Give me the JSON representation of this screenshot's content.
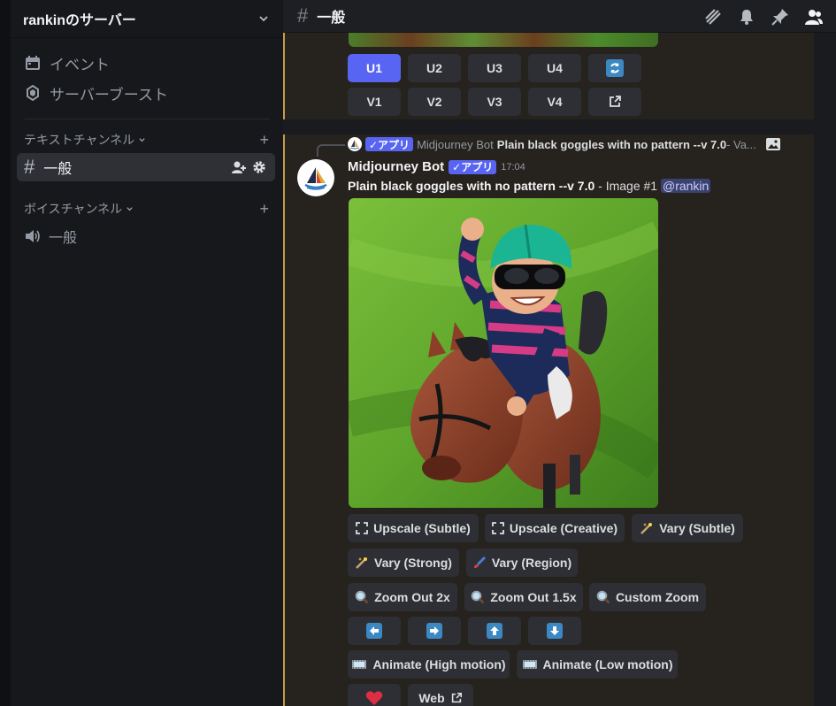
{
  "server": {
    "name": "rankinのサーバー"
  },
  "sidebar": {
    "events_label": "イベント",
    "boost_label": "サーバーブースト",
    "text_category": "テキストチャンネル",
    "text_channel": "一般",
    "voice_category": "ボイスチャンネル",
    "voice_channel": "一般"
  },
  "header": {
    "channel": "一般"
  },
  "message1": {
    "buttons_row1": [
      "U1",
      "U2",
      "U3",
      "U4"
    ],
    "buttons_row2": [
      "V1",
      "V2",
      "V3",
      "V4"
    ]
  },
  "message2": {
    "reply": {
      "tag": "✓アプリ",
      "author": "Midjourney Bot",
      "text": "Plain black goggles with no pattern --v 7.0",
      "suffix": " - Va..."
    },
    "author": "Midjourney Bot",
    "tag": "✓アプリ",
    "time": "17:04",
    "prompt": "Plain black goggles with no pattern --v 7.0",
    "image_label": " - Image #1 ",
    "mention": "@rankin",
    "buttons": {
      "upscale_subtle": "Upscale (Subtle)",
      "upscale_creative": "Upscale (Creative)",
      "vary_subtle": "Vary (Subtle)",
      "vary_strong": "Vary (Strong)",
      "vary_region": "Vary (Region)",
      "zoom_out_2x": "Zoom Out 2x",
      "zoom_out_15x": "Zoom Out 1.5x",
      "custom_zoom": "Custom Zoom",
      "animate_high": "Animate (High motion)",
      "animate_low": "Animate (Low motion)",
      "web": "Web"
    }
  },
  "colors": {
    "accent": "#5865f2",
    "highlight_border": "#c59c4a"
  }
}
